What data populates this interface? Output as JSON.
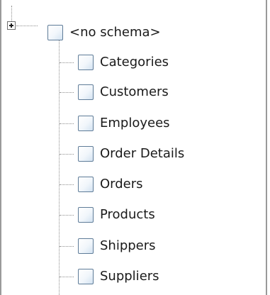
{
  "tree": {
    "root": {
      "label": "<no schema>",
      "expander": "plus-icon",
      "checked": false
    },
    "children": [
      {
        "label": "Categories",
        "checked": false
      },
      {
        "label": "Customers",
        "checked": false
      },
      {
        "label": "Employees",
        "checked": false
      },
      {
        "label": "Order Details",
        "checked": false
      },
      {
        "label": "Orders",
        "checked": false
      },
      {
        "label": "Products",
        "checked": false
      },
      {
        "label": "Shippers",
        "checked": false
      },
      {
        "label": "Suppliers",
        "checked": false
      }
    ]
  },
  "colors": {
    "checkbox_border": "#5f7c98",
    "tree_line": "#8e8e8e",
    "text": "#1a1a1a",
    "panel_border": "#9a9a9a"
  }
}
